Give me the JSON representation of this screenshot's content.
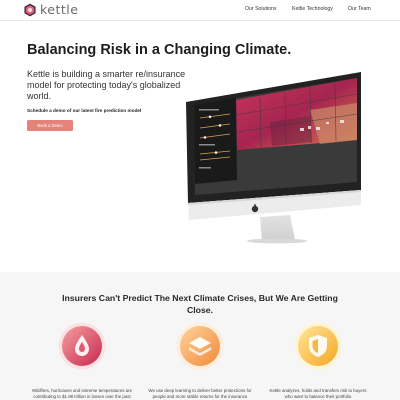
{
  "brand": {
    "name": "kettle",
    "accent": "#e5837b",
    "logo_icon": "kettle-logo-icon"
  },
  "nav": {
    "items": [
      "Our Solutions",
      "Kettle Technology",
      "Our Team"
    ]
  },
  "hero": {
    "title": "Balancing Risk in a Changing Climate.",
    "subtitle": "Kettle is building a smarter re/insurance model for protecting today's globalized world.",
    "demo_text": "Schedule a demo of our latest fire prediction model",
    "cta_label": "Book a Demo"
  },
  "section": {
    "title": "Insurers Can't Predict The Next Climate Crises, But We Are Getting Close."
  },
  "features": [
    {
      "icon": "flame-drop-icon",
      "colors": [
        "#f28b8b",
        "#c8284e"
      ],
      "text": "Wildfires, hurricanes and extreme temperatures are contributing to $1.98 trillion in losses over the past"
    },
    {
      "icon": "layers-icon",
      "colors": [
        "#ffc48a",
        "#f08a3c"
      ],
      "text": "We use deep learning to deliver better protections for people and more stable returns for the insurance"
    },
    {
      "icon": "shield-icon",
      "colors": [
        "#ffe08a",
        "#f5a623"
      ],
      "text": "Kettle analyzes, holds and transfers risk to buyers who want to balance their portfolio"
    }
  ]
}
